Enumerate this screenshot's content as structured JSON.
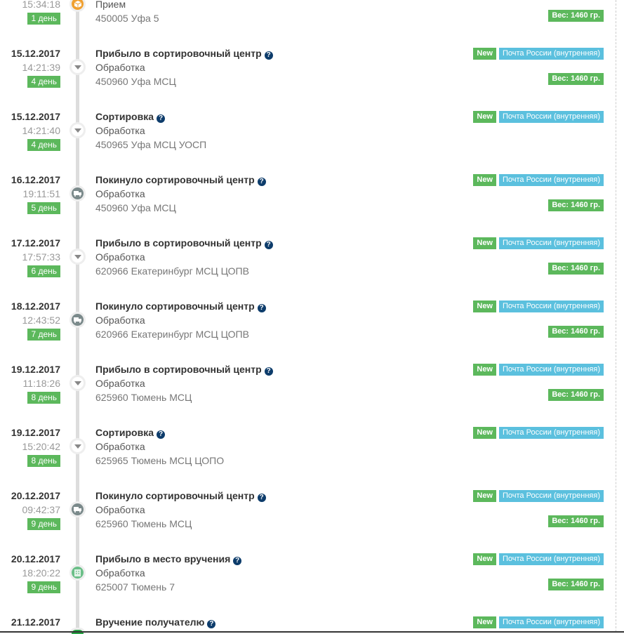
{
  "badges": {
    "new": "New",
    "service": "Почта России (внутренняя)",
    "weight": "Вес: 1460 гр."
  },
  "events": [
    {
      "date": "",
      "time": "15:34:18",
      "day": "1 день",
      "title": "",
      "operation": "Прием",
      "address": "450005 Уфа 5",
      "icon": "box-icon",
      "weight": true,
      "tags": false
    },
    {
      "date": "15.12.2017",
      "time": "14:21:39",
      "day": "4 день",
      "title": "Прибыло в сортировочный центр",
      "operation": "Обработка",
      "address": "450960 Уфа МСЦ",
      "icon": "arrow-down-icon",
      "weight": true,
      "tags": true
    },
    {
      "date": "15.12.2017",
      "time": "14:21:40",
      "day": "4 день",
      "title": "Сортировка",
      "operation": "Обработка",
      "address": "450965 Уфа МСЦ УОСП",
      "icon": "arrow-down-icon",
      "weight": false,
      "tags": true
    },
    {
      "date": "16.12.2017",
      "time": "19:11:51",
      "day": "5 день",
      "title": "Покинуло сортировочный центр",
      "operation": "Обработка",
      "address": "450960 Уфа МСЦ",
      "icon": "truck-icon",
      "weight": true,
      "tags": true
    },
    {
      "date": "17.12.2017",
      "time": "17:57:33",
      "day": "6 день",
      "title": "Прибыло в сортировочный центр",
      "operation": "Обработка",
      "address": "620966 Екатеринбург МСЦ ЦОПВ",
      "icon": "arrow-down-icon",
      "weight": true,
      "tags": true
    },
    {
      "date": "18.12.2017",
      "time": "12:43:52",
      "day": "7 день",
      "title": "Покинуло сортировочный центр",
      "operation": "Обработка",
      "address": "620966 Екатеринбург МСЦ ЦОПВ",
      "icon": "truck-icon",
      "weight": true,
      "tags": true
    },
    {
      "date": "19.12.2017",
      "time": "11:18:26",
      "day": "8 день",
      "title": "Прибыло в сортировочный центр",
      "operation": "Обработка",
      "address": "625960 Тюмень МСЦ",
      "icon": "arrow-down-icon",
      "weight": true,
      "tags": true
    },
    {
      "date": "19.12.2017",
      "time": "15:20:42",
      "day": "8 день",
      "title": "Сортировка",
      "operation": "Обработка",
      "address": "625965 Тюмень МСЦ ЦОПО",
      "icon": "arrow-down-icon",
      "weight": false,
      "tags": true
    },
    {
      "date": "20.12.2017",
      "time": "09:42:37",
      "day": "9 день",
      "title": "Покинуло сортировочный центр",
      "operation": "Обработка",
      "address": "625960 Тюмень МСЦ",
      "icon": "truck-icon",
      "weight": true,
      "tags": true
    },
    {
      "date": "20.12.2017",
      "time": "18:20:22",
      "day": "9 день",
      "title": "Прибыло в место вручения",
      "operation": "Обработка",
      "address": "625007 Тюмень 7",
      "icon": "building-icon",
      "weight": true,
      "tags": true
    },
    {
      "date": "21.12.2017",
      "time": "",
      "day": "",
      "title": "Вручение получателю",
      "operation": "",
      "address": "",
      "icon": "check-icon",
      "weight": false,
      "tags": true
    }
  ]
}
